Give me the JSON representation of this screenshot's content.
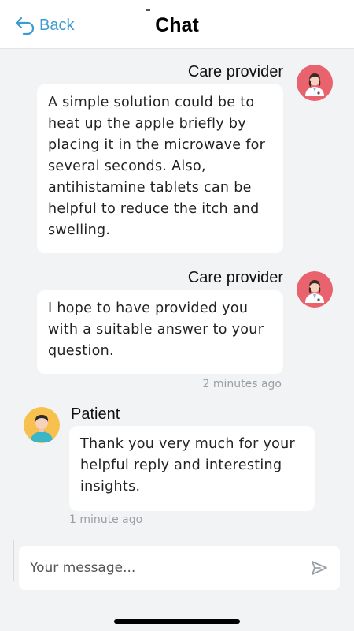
{
  "header": {
    "back_label": "Back",
    "title": "Chat"
  },
  "messages": [
    {
      "sender": "Care provider",
      "text": "A simple solution could be to heat up the apple briefly by placing it in the microwave for several seconds. Also, antihistamine tablets can be helpful to reduce the itch and swelling."
    },
    {
      "sender": "Care provider",
      "text": "I hope to have provided you with a suitable answer to your question.",
      "time": "2 minutes ago"
    },
    {
      "sender": "Patient",
      "text": "Thank you very much for your helpful reply and interesting insights.",
      "time": "1 minute ago"
    }
  ],
  "composer": {
    "placeholder": "Your message..."
  },
  "colors": {
    "accent": "#3b9ad3",
    "provider_avatar_bg": "#e8636d",
    "patient_avatar_bg": "#f7c04f"
  },
  "icons": {
    "back": "back-arrow-icon",
    "send": "send-icon"
  }
}
